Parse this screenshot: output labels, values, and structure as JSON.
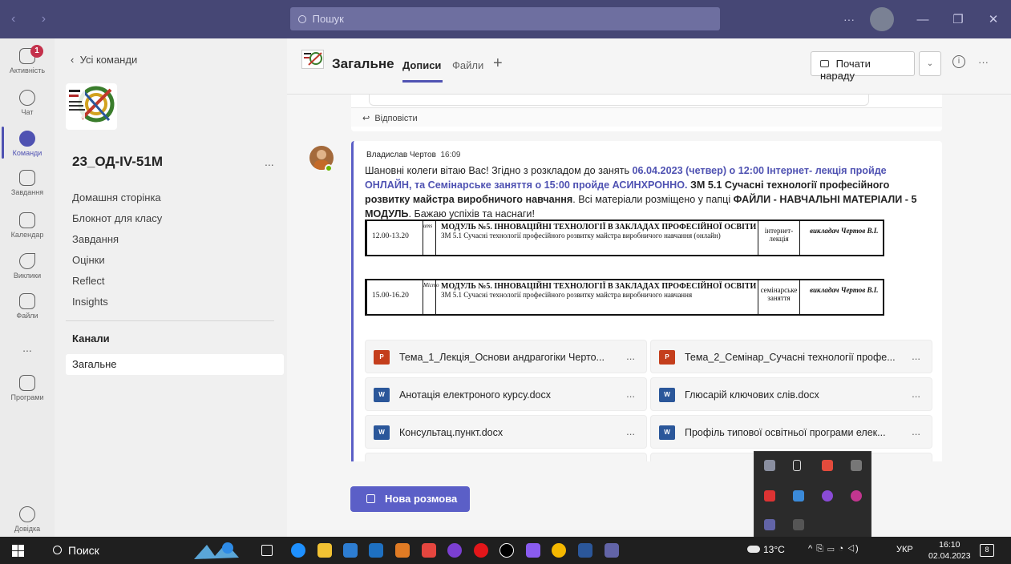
{
  "search": {
    "placeholder": "Пошук"
  },
  "rail": {
    "activity": "Активність",
    "activity_badge": "1",
    "chat": "Чат",
    "teams": "Команди",
    "assignments": "Завдання",
    "calendar": "Календар",
    "calls": "Виклики",
    "files": "Файли",
    "more": "...",
    "apps": "Програми",
    "help": "Довідка"
  },
  "panel": {
    "back": "Усі команди",
    "team_name": "23_ОД-IV-51М",
    "team_more": "...",
    "nav": [
      "Домашня сторінка",
      "Блокнот для класу",
      "Завдання",
      "Оцінки",
      "Reflect",
      "Insights"
    ],
    "channels_title": "Канали",
    "channel": "Загальне"
  },
  "header": {
    "channel_name": "Загальне",
    "tab_posts": "Дописи",
    "tab_files": "Файли",
    "meet_label": "Почати нараду"
  },
  "reply_label": "Відповісти",
  "post": {
    "author": "Владислав Чертов",
    "time": "16:09",
    "t1": "Шановні колеги вітаю Вас! Згідно з розкладом до занять ",
    "h1": "06.04.2023 (четвер) о 12:00 Інтернет- лекція пройде ОНЛАЙН, та Семінарське заняття о 15:00 пройде АСИНХРОННО.",
    "b1": " ЗМ 5.1 Сучасні технології професійного розвитку майстра виробничого навчання",
    "t2": ". Всі матеріали розміщено у папці ",
    "b2": "ФАЙЛИ - НАВЧАЛЬНІ МАТЕРІАЛИ - 5 МОДУЛЬ",
    "t3": ". Бажаю успіхів та наснаги!"
  },
  "schedule": [
    {
      "time": "12.00-13.20",
      "vert": "ums",
      "title": "МОДУЛЬ №5. ІННОВАЦІЙНІ ТЕХНОЛОГІЇ В ЗАКЛАДАХ ПРОФЕСІЙНОЇ ОСВІТИ",
      "sub": "ЗМ 5.1 Сучасні технології професійного розвитку майстра виробничого навчання (онлайн)",
      "form": "інтернет- лекція",
      "teacher": "викладач Чертов В.І."
    },
    {
      "time": "15.00-16.20",
      "vert": "Місто",
      "title": "МОДУЛЬ №5. ІННОВАЦІЙНІ ТЕХНОЛОГІЇ В ЗАКЛАДАХ ПРОФЕСІЙНОЇ ОСВІТИ",
      "sub": "ЗМ 5.1 Сучасні технології професійного розвитку майстра виробничого навчання",
      "form": "семінарське заняття",
      "teacher": "викладач Чертов В.І."
    }
  ],
  "files": [
    {
      "type": "ppt",
      "name": "Тема_1_Лекція_Основи андрагогіки Черто..."
    },
    {
      "type": "ppt",
      "name": "Тема_2_Семінар_Сучасні технології профе..."
    },
    {
      "type": "doc",
      "name": "Анотація електроного курсу.docx"
    },
    {
      "type": "doc",
      "name": "Глюсарій ключових слів.docx"
    },
    {
      "type": "doc",
      "name": "Консультац.пункт.docx"
    },
    {
      "type": "doc",
      "name": "Профіль типової освітньої програми елек..."
    }
  ],
  "file_more": "...",
  "new_conversation": "Нова розмова",
  "taskbar": {
    "search": "Поиск",
    "weather": "13°C",
    "lang": "УКР",
    "time": "16:10",
    "date": "02.04.2023",
    "notif": "8"
  },
  "colors": {
    "accent": "#5b5fc7",
    "titlebar": "#464775",
    "presence": "#6bb700"
  }
}
